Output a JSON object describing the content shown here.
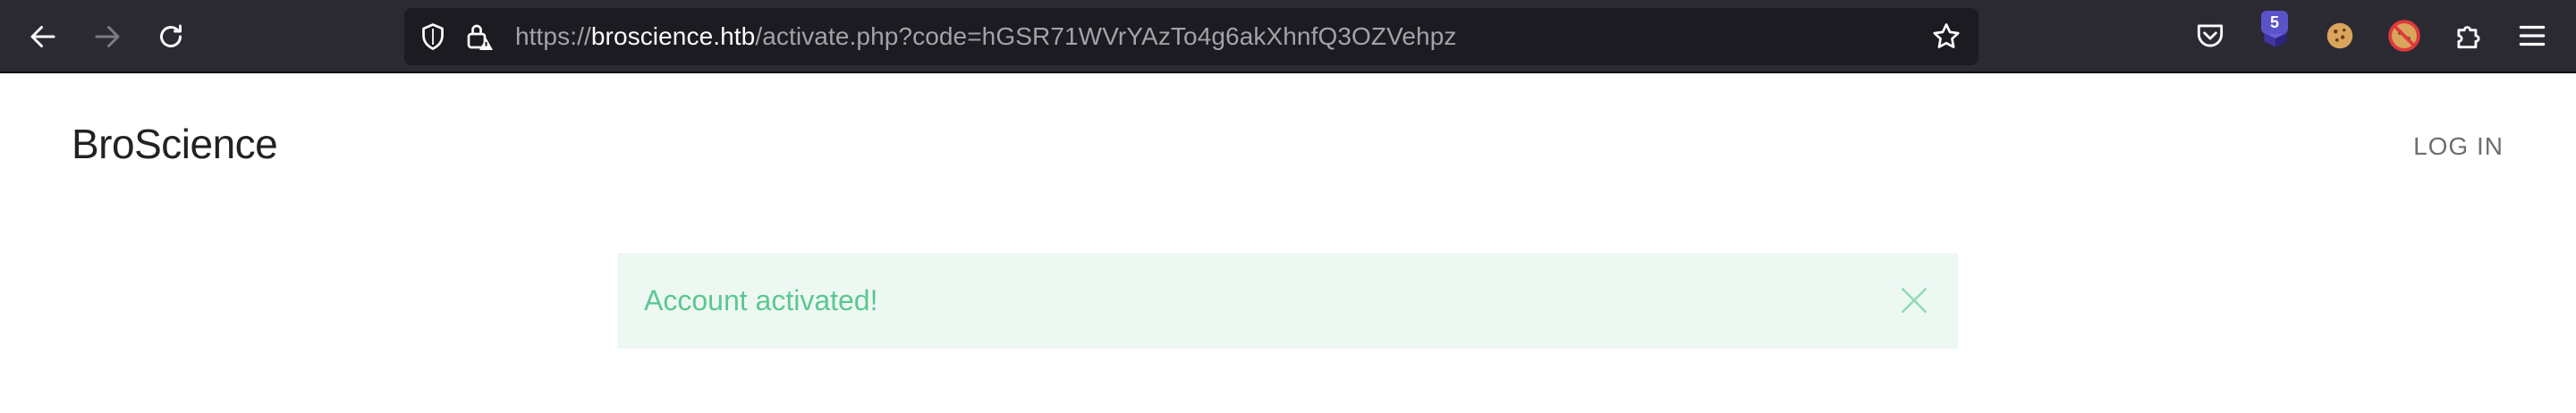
{
  "browser": {
    "url": {
      "scheme": "https://",
      "host": "broscience.htb",
      "path": "/activate.php?code=hGSR71WVrYAzTo4g6akXhnfQ3OZVehpz"
    },
    "extension_badge": "5",
    "icons": {
      "back": "back-arrow-icon",
      "forward": "forward-arrow-icon",
      "reload": "reload-icon",
      "shield": "shield-icon",
      "lock": "lock-warning-icon",
      "bookmark": "star-icon",
      "pocket": "pocket-icon",
      "extension": "extension-icon",
      "cookie": "cookie-icon",
      "cookie_block": "cookie-block-icon",
      "extensions": "puzzle-icon",
      "menu": "hamburger-menu-icon"
    }
  },
  "page": {
    "brand": "BroScience",
    "login": "LOG IN",
    "alert": {
      "message": "Account activated!",
      "close_icon": "close-icon"
    }
  },
  "colors": {
    "toolbar_bg": "#2b2a33",
    "urlbar_bg": "#1c1b22",
    "alert_bg": "#eef8f3",
    "alert_text": "#5bc891",
    "badge": "#5b53c9"
  }
}
